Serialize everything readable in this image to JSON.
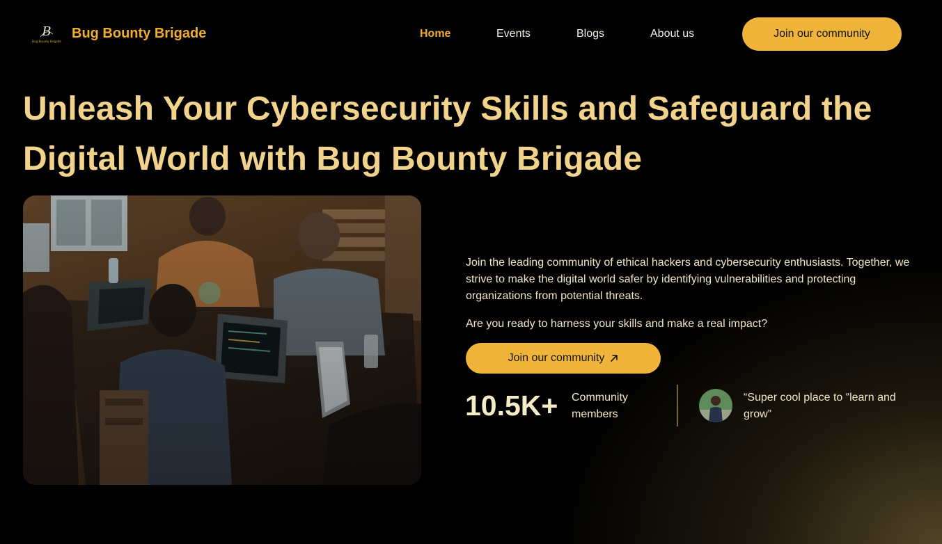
{
  "header": {
    "brand": "Bug Bounty Brigade",
    "logo_letter": "B",
    "logo_text": "Bug Bounty Brigade",
    "nav": {
      "home": "Home",
      "events": "Events",
      "blogs": "Blogs",
      "about": "About us"
    },
    "cta_label": "Join our community"
  },
  "hero": {
    "headline": "Unleash Your Cybersecurity Skills and Safeguard the Digital World with Bug Bounty Brigade",
    "description": "Join the leading community of ethical hackers and cybersecurity enthusiasts. Together, we strive to make the digital world safer by identifying vulnerabilities and protecting organizations from potential threats.",
    "question": "Are you ready to harness your skills and make a real impact?",
    "cta_label": "Join our community",
    "cta_icon": "arrow-up-right-icon",
    "stat_value": "10.5K+",
    "stat_label": "Community members",
    "testimonial": "“Super cool place to “learn and grow”"
  },
  "colors": {
    "accent": "#f0b43a",
    "brand_text": "#f0ad2e",
    "headline": "#f1d38c",
    "body_text": "#f2e6c4",
    "background": "#000000"
  }
}
